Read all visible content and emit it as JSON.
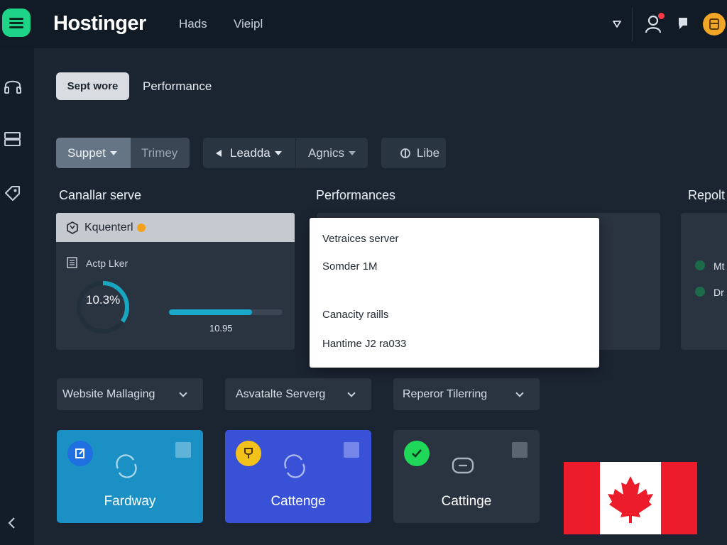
{
  "header": {
    "brand": "Hostinger",
    "nav": [
      "Hads",
      "Vieipl"
    ],
    "icons": [
      "menu-icon",
      "dropdown-arrow-icon",
      "user-icon",
      "bell-icon",
      "avatar-icon"
    ],
    "accent": "#1ed489"
  },
  "sidebar": {
    "icons": [
      "headset-icon",
      "server-icon",
      "tag-icon",
      "collapse-arrow-icon"
    ]
  },
  "tabs": {
    "active": "Sept wore",
    "other": "Performance"
  },
  "toolbar": {
    "group1": {
      "primary": "Suppet",
      "secondary": "Trimey"
    },
    "group2": {
      "primary": "Leadda",
      "secondary": "Agnics"
    },
    "lib": "Libe"
  },
  "sections": {
    "left": "Canallar serve",
    "middle": "Performances",
    "right": "Repolt"
  },
  "card": {
    "header": "Kquenterl",
    "subtitle": "Actp Lker",
    "gauge_value": "10.3%",
    "gauge_fraction": 0.35,
    "bar_fraction": 0.73,
    "bar_value": "10.95"
  },
  "popup": {
    "items": [
      "Vetraices server",
      "Somder 1M",
      "Canacity raills",
      "Hantime J2 ra033"
    ]
  },
  "report": {
    "items": [
      "Mt",
      "Dr"
    ],
    "dot_color": "#1b6b4a"
  },
  "dropdowns": [
    "Website Mallaging",
    "Asvatalte Serverg",
    "Reperor Tilerring"
  ],
  "tiles": [
    {
      "label": "Fardway",
      "color": "#1a90c4",
      "badge_color": "#1f6fe0",
      "badge_icon": "edit-icon"
    },
    {
      "label": "Cattenge",
      "color": "#3851d6",
      "badge_color": "#f3c21a",
      "badge_icon": "trophy-icon"
    },
    {
      "label": "Cattinge",
      "color": "#2a3440",
      "badge_color": "#1fd85a",
      "badge_icon": "check-icon"
    }
  ],
  "flag": {
    "name": "canada-flag-icon",
    "red": "#ec1c2a"
  }
}
